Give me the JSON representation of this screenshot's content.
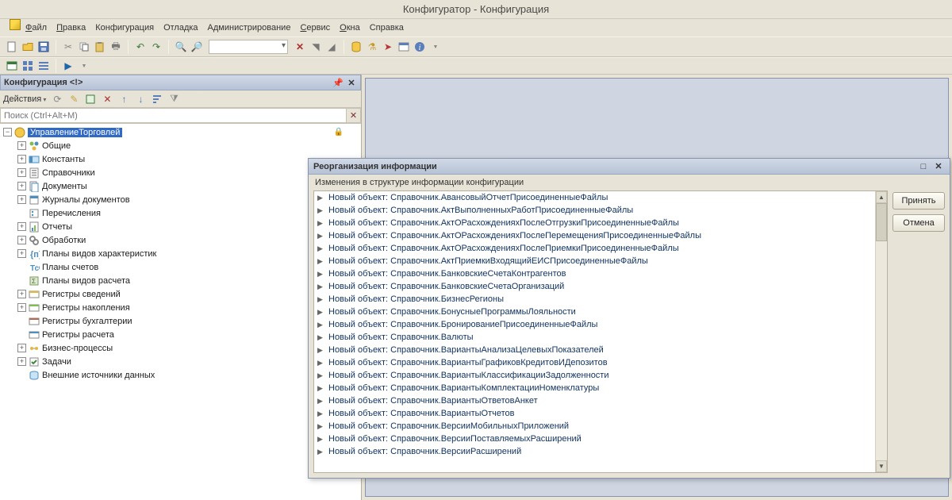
{
  "app": {
    "title": "Конфигуратор - Конфигурация"
  },
  "menu": {
    "file": "Файл",
    "edit": "Правка",
    "config": "Конфигурация",
    "debug": "Отладка",
    "admin": "Администрирование",
    "service": "Сервис",
    "windows": "Окна",
    "help": "Справка"
  },
  "panel": {
    "title": "Конфигурация <!>",
    "actions_label": "Действия",
    "search_placeholder": "Поиск (Ctrl+Alt+M)"
  },
  "tree": {
    "root": "УправлениеТорговлей",
    "items": [
      {
        "label": "Общие",
        "icon": "common",
        "expandable": true
      },
      {
        "label": "Константы",
        "icon": "const",
        "expandable": true
      },
      {
        "label": "Справочники",
        "icon": "catalog",
        "expandable": true
      },
      {
        "label": "Документы",
        "icon": "docs",
        "expandable": true
      },
      {
        "label": "Журналы документов",
        "icon": "journals",
        "expandable": true
      },
      {
        "label": "Перечисления",
        "icon": "enum",
        "expandable": false
      },
      {
        "label": "Отчеты",
        "icon": "reports",
        "expandable": true
      },
      {
        "label": "Обработки",
        "icon": "proc",
        "expandable": true
      },
      {
        "label": "Планы видов характеристик",
        "icon": "char",
        "expandable": true
      },
      {
        "label": "Планы счетов",
        "icon": "accounts",
        "expandable": false
      },
      {
        "label": "Планы видов расчета",
        "icon": "calc",
        "expandable": false
      },
      {
        "label": "Регистры сведений",
        "icon": "inforeg",
        "expandable": true
      },
      {
        "label": "Регистры накопления",
        "icon": "accumreg",
        "expandable": true
      },
      {
        "label": "Регистры бухгалтерии",
        "icon": "accreg",
        "expandable": false
      },
      {
        "label": "Регистры расчета",
        "icon": "calcreg",
        "expandable": false
      },
      {
        "label": "Бизнес-процессы",
        "icon": "bp",
        "expandable": true
      },
      {
        "label": "Задачи",
        "icon": "tasks",
        "expandable": true
      },
      {
        "label": "Внешние источники данных",
        "icon": "ext",
        "expandable": false
      }
    ]
  },
  "dialog": {
    "title": "Реорганизация информации",
    "subtitle": "Изменения в структуре информации конфигурации",
    "accept": "Принять",
    "cancel": "Отмена",
    "prefix": "Новый объект: ",
    "items": [
      "Справочник.АвансовыйОтчетПрисоединенныеФайлы",
      "Справочник.АктВыполненныхРаботПрисоединенныеФайлы",
      "Справочник.АктОРасхожденияхПослеОтгрузкиПрисоединенныеФайлы",
      "Справочник.АктОРасхожденияхПослеПеремещенияПрисоединенныеФайлы",
      "Справочник.АктОРасхожденияхПослеПриемкиПрисоединенныеФайлы",
      "Справочник.АктПриемкиВходящийЕИСПрисоединенныеФайлы",
      "Справочник.БанковскиеСчетаКонтрагентов",
      "Справочник.БанковскиеСчетаОрганизаций",
      "Справочник.БизнесРегионы",
      "Справочник.БонусныеПрограммыЛояльности",
      "Справочник.БронированиеПрисоединенныеФайлы",
      "Справочник.Валюты",
      "Справочник.ВариантыАнализаЦелевыхПоказателей",
      "Справочник.ВариантыГрафиковКредитовИДепозитов",
      "Справочник.ВариантыКлассификацииЗадолженности",
      "Справочник.ВариантыКомплектацииНоменклатуры",
      "Справочник.ВариантыОтветовАнкет",
      "Справочник.ВариантыОтчетов",
      "Справочник.ВерсииМобильныхПриложений",
      "Справочник.ВерсииПоставляемыхРасширений",
      "Справочник.ВерсииРасширений"
    ]
  }
}
